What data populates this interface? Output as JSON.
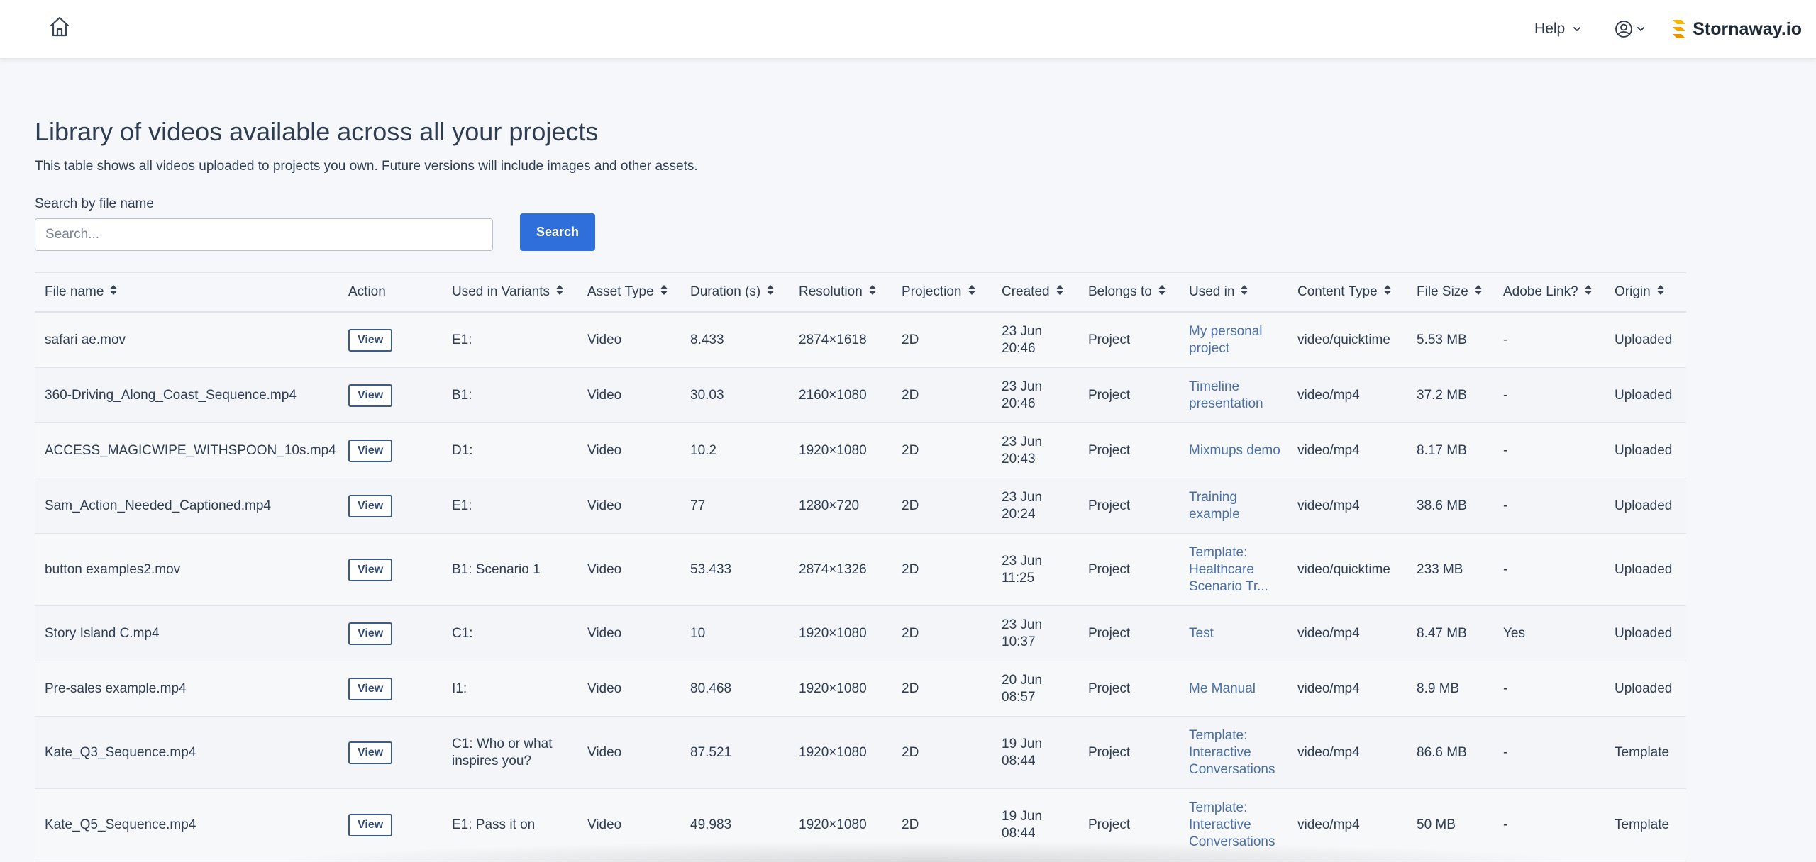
{
  "header": {
    "help_label": "Help",
    "brand_name": "Stornaway.io"
  },
  "main": {
    "title": "Library of videos available across all your projects",
    "description": "This table shows all videos uploaded to projects you own. Future versions will include images and other assets.",
    "search": {
      "label": "Search by file name",
      "placeholder": "Search...",
      "value": "",
      "button_label": "Search"
    }
  },
  "table": {
    "columns": [
      {
        "label": "File name",
        "sortable": true
      },
      {
        "label": "Action",
        "sortable": false
      },
      {
        "label": "Used in Variants",
        "sortable": true
      },
      {
        "label": "Asset Type",
        "sortable": true
      },
      {
        "label": "Duration (s)",
        "sortable": true
      },
      {
        "label": "Resolution",
        "sortable": true
      },
      {
        "label": "Projection",
        "sortable": true
      },
      {
        "label": "Created",
        "sortable": true
      },
      {
        "label": "Belongs to",
        "sortable": true
      },
      {
        "label": "Used in",
        "sortable": true
      },
      {
        "label": "Content Type",
        "sortable": true
      },
      {
        "label": "File Size",
        "sortable": true
      },
      {
        "label": "Adobe Link?",
        "sortable": true
      },
      {
        "label": "Origin",
        "sortable": true
      }
    ],
    "view_label": "View",
    "rows": [
      {
        "file": "safari ae.mov",
        "variants": "E1:",
        "asset_type": "Video",
        "duration": "8.433",
        "resolution": "2874×1618",
        "projection": "2D",
        "created_date": "23 Jun",
        "created_time": "20:46",
        "belongs_to": "Project",
        "used_in": "My personal project",
        "content_type": "video/quicktime",
        "file_size": "5.53 MB",
        "adobe": "-",
        "origin": "Uploaded"
      },
      {
        "file": "360-Driving_Along_Coast_Sequence.mp4",
        "variants": "B1:",
        "asset_type": "Video",
        "duration": "30.03",
        "resolution": "2160×1080",
        "projection": "2D",
        "created_date": "23 Jun",
        "created_time": "20:46",
        "belongs_to": "Project",
        "used_in": "Timeline presentation",
        "content_type": "video/mp4",
        "file_size": "37.2 MB",
        "adobe": "-",
        "origin": "Uploaded"
      },
      {
        "file": "ACCESS_MAGICWIPE_WITHSPOON_10s.mp4",
        "variants": "D1:",
        "asset_type": "Video",
        "duration": "10.2",
        "resolution": "1920×1080",
        "projection": "2D",
        "created_date": "23 Jun",
        "created_time": "20:43",
        "belongs_to": "Project",
        "used_in": "Mixmups demo",
        "content_type": "video/mp4",
        "file_size": "8.17 MB",
        "adobe": "-",
        "origin": "Uploaded"
      },
      {
        "file": "Sam_Action_Needed_Captioned.mp4",
        "variants": "E1:",
        "asset_type": "Video",
        "duration": "77",
        "resolution": "1280×720",
        "projection": "2D",
        "created_date": "23 Jun",
        "created_time": "20:24",
        "belongs_to": "Project",
        "used_in": "Training example",
        "content_type": "video/mp4",
        "file_size": "38.6 MB",
        "adobe": "-",
        "origin": "Uploaded"
      },
      {
        "file": "button examples2.mov",
        "variants": "B1: Scenario 1",
        "asset_type": "Video",
        "duration": "53.433",
        "resolution": "2874×1326",
        "projection": "2D",
        "created_date": "23 Jun",
        "created_time": "11:25",
        "belongs_to": "Project",
        "used_in": "Template: Healthcare Scenario Tr...",
        "content_type": "video/quicktime",
        "file_size": "233 MB",
        "adobe": "-",
        "origin": "Uploaded"
      },
      {
        "file": "Story Island C.mp4",
        "variants": "C1:",
        "asset_type": "Video",
        "duration": "10",
        "resolution": "1920×1080",
        "projection": "2D",
        "created_date": "23 Jun",
        "created_time": "10:37",
        "belongs_to": "Project",
        "used_in": "Test",
        "content_type": "video/mp4",
        "file_size": "8.47 MB",
        "adobe": "Yes",
        "origin": "Uploaded"
      },
      {
        "file": "Pre-sales example.mp4",
        "variants": "I1:",
        "asset_type": "Video",
        "duration": "80.468",
        "resolution": "1920×1080",
        "projection": "2D",
        "created_date": "20 Jun",
        "created_time": "08:57",
        "belongs_to": "Project",
        "used_in": "Me Manual",
        "content_type": "video/mp4",
        "file_size": "8.9 MB",
        "adobe": "-",
        "origin": "Uploaded"
      },
      {
        "file": "Kate_Q3_Sequence.mp4",
        "variants": "C1: Who or what inspires you?",
        "asset_type": "Video",
        "duration": "87.521",
        "resolution": "1920×1080",
        "projection": "2D",
        "created_date": "19 Jun",
        "created_time": "08:44",
        "belongs_to": "Project",
        "used_in": "Template: Interactive Conversations",
        "content_type": "video/mp4",
        "file_size": "86.6 MB",
        "adobe": "-",
        "origin": "Template"
      },
      {
        "file": "Kate_Q5_Sequence.mp4",
        "variants": "E1: Pass it on",
        "asset_type": "Video",
        "duration": "49.983",
        "resolution": "1920×1080",
        "projection": "2D",
        "created_date": "19 Jun",
        "created_time": "08:44",
        "belongs_to": "Project",
        "used_in": "Template: Interactive Conversations",
        "content_type": "video/mp4",
        "file_size": "50 MB",
        "adobe": "-",
        "origin": "Template"
      }
    ]
  }
}
